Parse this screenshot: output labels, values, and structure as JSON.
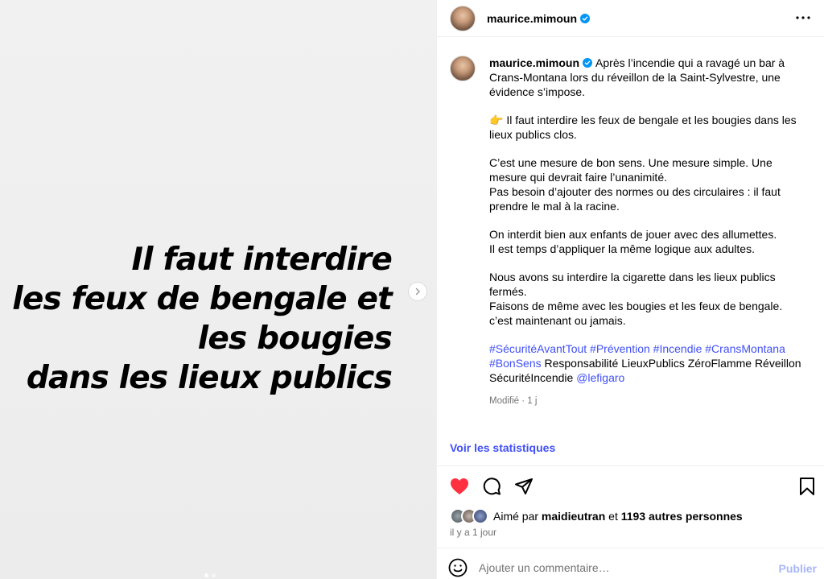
{
  "media": {
    "lines": [
      "Il faut interdire",
      "les feux de bengale et",
      "les bougies",
      "dans les lieux publics"
    ]
  },
  "header": {
    "username": "maurice.mimoun"
  },
  "caption": {
    "username": "maurice.mimoun",
    "paragraphs": [
      "Après l’incendie qui a ravagé un bar à Crans-Montana lors du réveillon de la Saint-Sylvestre, une évidence s’impose.",
      "👉 Il faut interdire les feux de bengale et les bougies dans les lieux publics clos.",
      "C’est une mesure de bon sens. Une mesure simple. Une mesure qui devrait faire l’unanimité.",
      "Pas besoin d’ajouter des normes ou des circulaires : il faut prendre le mal à la racine.",
      "On interdit bien aux enfants de jouer avec des allumettes.",
      "Il est temps d’appliquer la même logique aux adultes.",
      "Nous avons su interdire la cigarette dans les lieux publics fermés.",
      "Faisons de même avec les bougies et les feux de bengale.",
      "c’est maintenant ou jamais."
    ],
    "hashtags": [
      "#SécuritéAvantTout",
      "#Prévention",
      "#Incendie",
      "#CransMontana",
      "#BonSens"
    ],
    "plain_tags": "Responsabilité LieuxPublics ZéroFlamme Réveillon SécuritéIncendie",
    "mention": "@lefigaro",
    "meta": "Modifié · 1 j"
  },
  "stats_link": "Voir les statistiques",
  "likes": {
    "prefix": "Aimé par",
    "user": "maidieutran",
    "joiner": "et",
    "others": "1193 autres personnes"
  },
  "time": "il y a 1 jour",
  "comment": {
    "placeholder": "Ajouter un commentaire…",
    "publish": "Publier"
  },
  "colors": {
    "link": "#4150f7",
    "heart": "#ff3040",
    "publish_disabled": "#a8b6fa",
    "verified": "#0095f6"
  },
  "icons": [
    "chevron-right-icon",
    "verified-badge-icon",
    "more-icon",
    "heart-icon",
    "comment-icon",
    "share-icon",
    "bookmark-icon",
    "emoji-icon"
  ]
}
